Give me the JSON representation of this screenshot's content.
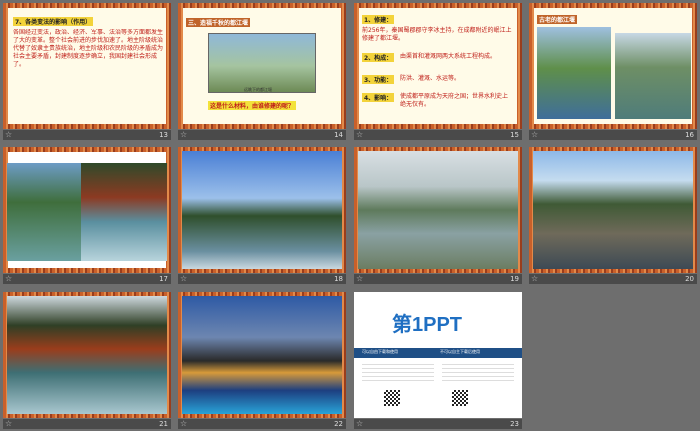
{
  "slides": [
    {
      "num": "13",
      "title": "7、各类变法的影响（作用）",
      "body": "各国经过变法，政治、经济、军事、法治等多方面都发生了大的变革。整个社会前进的步伐加速了。地主阶级统治代替了奴隶主贵族统治，地主阶级和农民阶级的矛盾成为社会主要矛盾，封建制度逐步确立，我国封建社会形成了。"
    },
    {
      "num": "14",
      "title": "三、造福千秋的都江堰",
      "caption": "这是什么材料，由谁修建的呢？",
      "photo_caption": "远眺下的都江堰"
    },
    {
      "num": "15",
      "items": [
        {
          "label": "1、修建：",
          "text": "前256年，秦国蜀郡郡守李冰主持，在成都附近的岷江上修建了都江堰。"
        },
        {
          "label": "2、构成：",
          "text": "由渠首和灌溉网两大系统工程构成。"
        },
        {
          "label": "3、功能：",
          "text": "防洪、灌溉、水运等。"
        },
        {
          "label": "4、影响：",
          "text": "使成都平原成为天府之国；世界水利史上绝无仅有。"
        }
      ]
    },
    {
      "num": "16",
      "title": "古老的都江堰"
    },
    {
      "num": "17"
    },
    {
      "num": "18"
    },
    {
      "num": "19"
    },
    {
      "num": "20"
    },
    {
      "num": "21"
    },
    {
      "num": "22"
    },
    {
      "num": "23",
      "logo": "第1PPT",
      "left_head": "可以自由下载和使用",
      "right_head": "不可以自主下载后使用"
    }
  ],
  "star": "☆"
}
